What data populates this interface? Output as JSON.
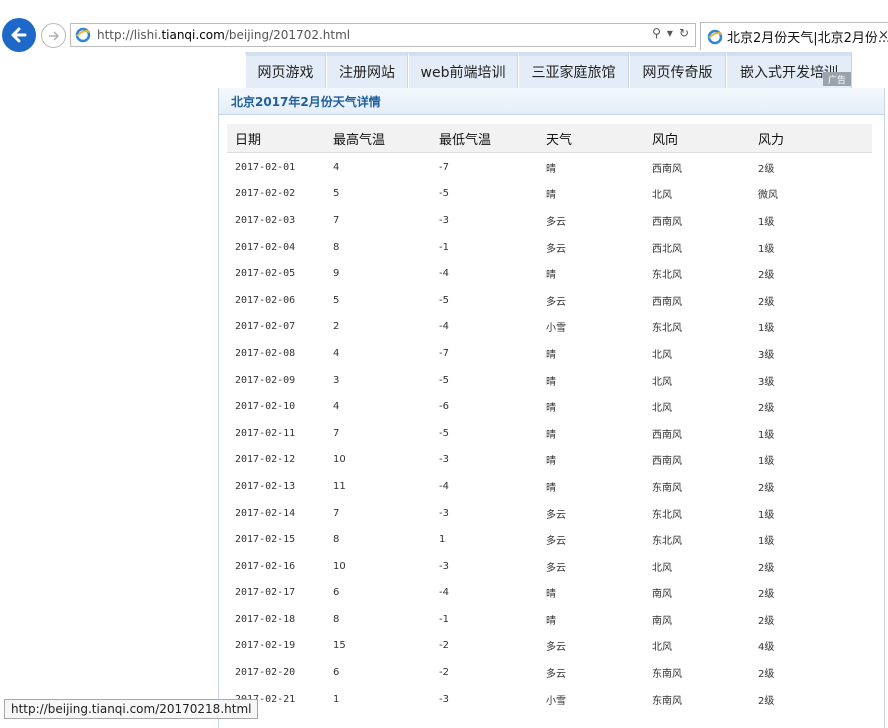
{
  "browser": {
    "address_prefix": "http://lishi.",
    "address_domain": "tianqi.com",
    "address_suffix": "/beijing/201702.html",
    "tab_title": "北京2月份天气|北京2月份...",
    "status_url": "http://beijing.tianqi.com/20170218.html"
  },
  "nav": {
    "items": [
      "网页游戏",
      "注册网站",
      "web前端培训",
      "三亚家庭旅馆",
      "网页传奇版",
      "嵌入式开发培训"
    ],
    "ad_label": "广告"
  },
  "panel": {
    "title": "北京2017年2月份天气详情"
  },
  "table": {
    "headers": [
      "日期",
      "最高气温",
      "最低气温",
      "天气",
      "风向",
      "风力"
    ],
    "rows": [
      [
        "2017-02-01",
        "4",
        "-7",
        "晴",
        "西南风",
        "2级"
      ],
      [
        "2017-02-02",
        "5",
        "-5",
        "晴",
        "北风",
        "微风"
      ],
      [
        "2017-02-03",
        "7",
        "-3",
        "多云",
        "西南风",
        "1级"
      ],
      [
        "2017-02-04",
        "8",
        "-1",
        "多云",
        "西北风",
        "1级"
      ],
      [
        "2017-02-05",
        "9",
        "-4",
        "晴",
        "东北风",
        "2级"
      ],
      [
        "2017-02-06",
        "5",
        "-5",
        "多云",
        "西南风",
        "2级"
      ],
      [
        "2017-02-07",
        "2",
        "-4",
        "小雪",
        "东北风",
        "1级"
      ],
      [
        "2017-02-08",
        "4",
        "-7",
        "晴",
        "北风",
        "3级"
      ],
      [
        "2017-02-09",
        "3",
        "-5",
        "晴",
        "北风",
        "3级"
      ],
      [
        "2017-02-10",
        "4",
        "-6",
        "晴",
        "北风",
        "2级"
      ],
      [
        "2017-02-11",
        "7",
        "-5",
        "晴",
        "西南风",
        "1级"
      ],
      [
        "2017-02-12",
        "10",
        "-3",
        "晴",
        "西南风",
        "1级"
      ],
      [
        "2017-02-13",
        "11",
        "-4",
        "晴",
        "东南风",
        "2级"
      ],
      [
        "2017-02-14",
        "7",
        "-3",
        "多云",
        "东北风",
        "1级"
      ],
      [
        "2017-02-15",
        "8",
        "1",
        "多云",
        "东北风",
        "1级"
      ],
      [
        "2017-02-16",
        "10",
        "-3",
        "多云",
        "北风",
        "2级"
      ],
      [
        "2017-02-17",
        "6",
        "-4",
        "晴",
        "南风",
        "2级"
      ],
      [
        "2017-02-18",
        "8",
        "-1",
        "晴",
        "南风",
        "2级"
      ],
      [
        "2017-02-19",
        "15",
        "-2",
        "多云",
        "北风",
        "4级"
      ],
      [
        "2017-02-20",
        "6",
        "-2",
        "多云",
        "东南风",
        "2级"
      ],
      [
        "2017-02-21",
        "1",
        "-3",
        "小雪",
        "东南风",
        "2级"
      ]
    ]
  },
  "colors": {
    "back_button": "#1d68c8",
    "panel_title": "#1f5f9c",
    "nav_bg": "#e3ecf7"
  }
}
